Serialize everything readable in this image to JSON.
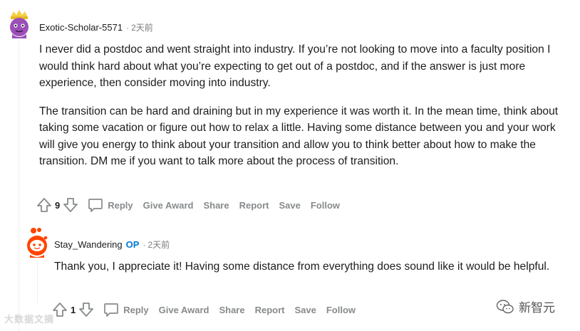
{
  "comments": [
    {
      "username": "Exotic-Scholar-5571",
      "time": "2天前",
      "paragraphs": [
        "I never did a postdoc and went straight into industry. If you’re not looking to move into a faculty position I would think hard about what you’re expecting to get out of a postdoc, and if the answer is just more experience, then consider moving into industry.",
        "The transition can be hard and draining but in my experience it was worth it. In the mean time, think about taking some vacation or figure out how to relax a little. Having some distance between you and your work will give you energy to think about your transition and allow you to think better about how to make the transition. DM me if you want to talk more about the process of transition."
      ],
      "votes": "9",
      "actions": {
        "reply": "Reply",
        "award": "Give Award",
        "share": "Share",
        "report": "Report",
        "save": "Save",
        "follow": "Follow"
      }
    },
    {
      "username": "Stay_Wandering",
      "op_badge": "OP",
      "time": "2天前",
      "paragraphs": [
        "Thank you, I appreciate it! Having some distance from everything does sound like it would be helpful."
      ],
      "votes": "1",
      "actions": {
        "reply": "Reply",
        "award": "Give Award",
        "share": "Share",
        "report": "Report",
        "save": "Save",
        "follow": "Follow"
      }
    }
  ],
  "separator": "·",
  "watermarks": {
    "left": "大数据文摘",
    "right": "新智元"
  },
  "colors": {
    "op": "#0079d3",
    "meta": "#7c7c7c",
    "action": "#878a8c"
  }
}
